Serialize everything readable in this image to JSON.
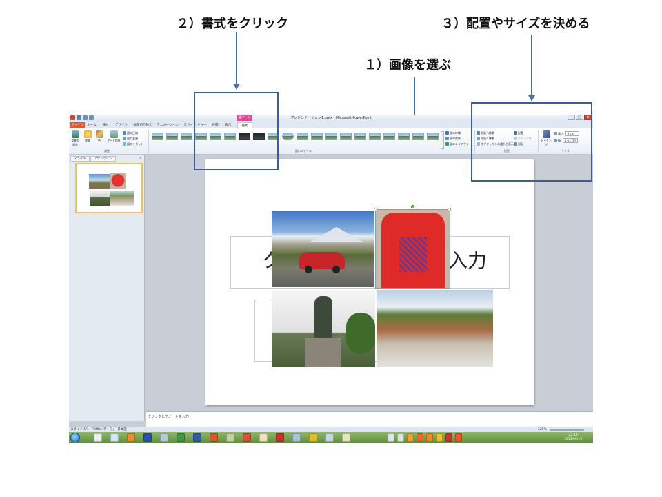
{
  "callouts": {
    "format": "２）書式をクリック",
    "select_image": "１）画像を選ぶ",
    "arrange": "３）配置やサイズを決める"
  },
  "window": {
    "title": "プレゼンテーション1.pptx - Microsoft PowerPoint",
    "context_tab": "図ツール"
  },
  "tabs": [
    "ファイル",
    "ホーム",
    "挿入",
    "デザイン",
    "画面切り替え",
    "アニメーション",
    "スライド ショー",
    "校閲",
    "表示",
    "書式"
  ],
  "ribbon": {
    "adjust": {
      "remove_bg": "背景の削除",
      "correct": "修整",
      "color": "色",
      "art_effects": "アート効果",
      "compress": "図の圧縮",
      "change": "図の変更",
      "reset": "図のリセット",
      "group_label": "調整"
    },
    "styles": {
      "group_label": "図のスタイル"
    },
    "style_options": {
      "border": "図の枠線",
      "effects": "図の効果",
      "layout": "図のレイアウト"
    },
    "arrange": {
      "front": "前面へ移動",
      "back": "背面へ移動",
      "selection_pane": "オブジェクトの選択と表示",
      "align": "配置",
      "group": "グループ化",
      "rotate": "回転",
      "group_label": "配置"
    },
    "size": {
      "crop": "トリミング",
      "height_label": "高さ:",
      "height_value": "6 cm",
      "width_label": "幅:",
      "width_value": "5.63 cm",
      "group_label": "サイズ"
    }
  },
  "left_pane": {
    "tab_slides": "スライド",
    "tab_outline": "アウトライン",
    "slide_number": "1"
  },
  "slide": {
    "title_placeholder_visible": [
      "ク",
      "入力"
    ]
  },
  "notes": {
    "placeholder": "クリックしてノートを入力"
  },
  "statusbar": {
    "slide_info": "スライド 1/1　「Office テーマ」　日本語",
    "zoom": "125%"
  },
  "taskbar": {
    "time": "22:18",
    "date": "2013/09/13"
  },
  "colors": {
    "accent": "#4a6fa5",
    "file_tab": "#e35b2c",
    "context_tab": "#e6469a",
    "taskbar": "#6a9a45"
  }
}
